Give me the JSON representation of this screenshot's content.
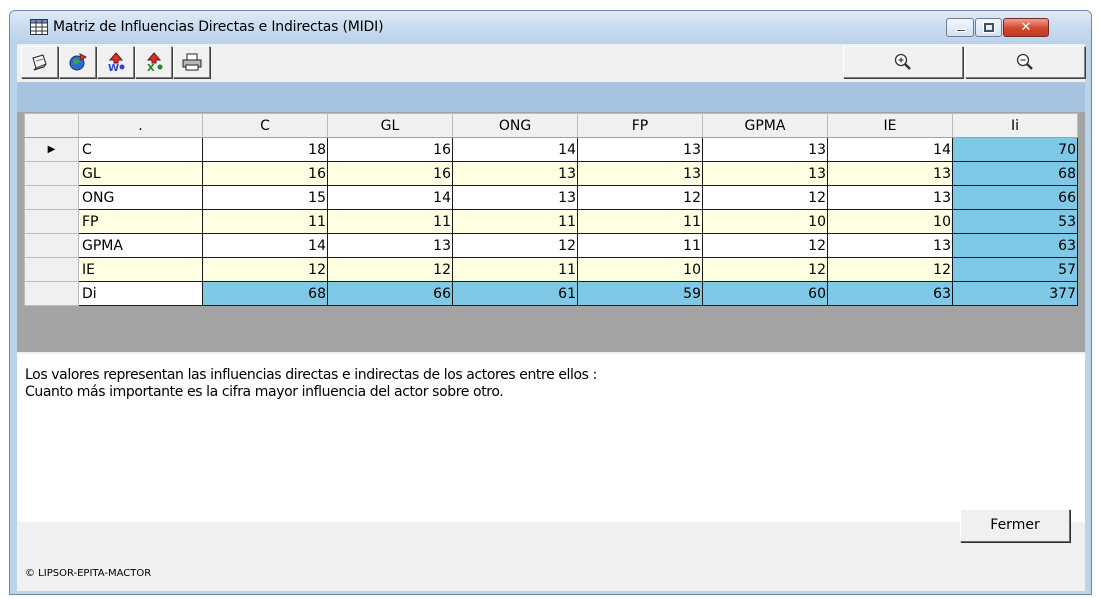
{
  "window": {
    "title": "Matriz de Influencias Directas e Indirectas (MIDI)",
    "controls": [
      "minimize-icon",
      "maximize-icon",
      "close-icon"
    ]
  },
  "toolbar": {
    "buttons": [
      {
        "icon": "copy-icon"
      },
      {
        "icon": "export-icon"
      },
      {
        "icon": "ranking-up-icon"
      },
      {
        "icon": "ranking-down-icon"
      },
      {
        "icon": "print-icon"
      }
    ],
    "zoom_in": {
      "icon": "zoom-in-icon"
    },
    "zoom_out": {
      "icon": "zoom-out-icon"
    }
  },
  "grid": {
    "corner_label": ".",
    "columns": [
      "C",
      "GL",
      "ONG",
      "FP",
      "GPMA",
      "IE",
      "Ii"
    ],
    "current_row_marker": "▶",
    "rows": [
      {
        "name": "C",
        "values": [
          "18",
          "16",
          "14",
          "13",
          "13",
          "14"
        ],
        "total": "70"
      },
      {
        "name": "GL",
        "values": [
          "16",
          "16",
          "13",
          "13",
          "13",
          "13"
        ],
        "total": "68"
      },
      {
        "name": "ONG",
        "values": [
          "15",
          "14",
          "13",
          "12",
          "12",
          "13"
        ],
        "total": "66"
      },
      {
        "name": "FP",
        "values": [
          "11",
          "11",
          "11",
          "11",
          "10",
          "10"
        ],
        "total": "53"
      },
      {
        "name": "GPMA",
        "values": [
          "14",
          "13",
          "12",
          "11",
          "12",
          "13"
        ],
        "total": "63"
      },
      {
        "name": "IE",
        "values": [
          "12",
          "12",
          "11",
          "10",
          "12",
          "12"
        ],
        "total": "57"
      }
    ],
    "totals_row": {
      "name": "Di",
      "values": [
        "68",
        "66",
        "61",
        "59",
        "60",
        "63"
      ],
      "total": "377"
    },
    "colors": {
      "odd_row": "#ffffff",
      "even_row": "#ffffe1",
      "sum_cell": "#7fc9e6",
      "header_band": "#a6c4df"
    }
  },
  "description": {
    "line1": "Los valores representan las influencias directas e indirectas de los actores entre ellos :",
    "line2": "Cuanto más importante es la cifra mayor influencia del actor sobre otro."
  },
  "footer": {
    "copyright": "© LIPSOR-EPITA-MACTOR",
    "close_label": "Fermer"
  }
}
